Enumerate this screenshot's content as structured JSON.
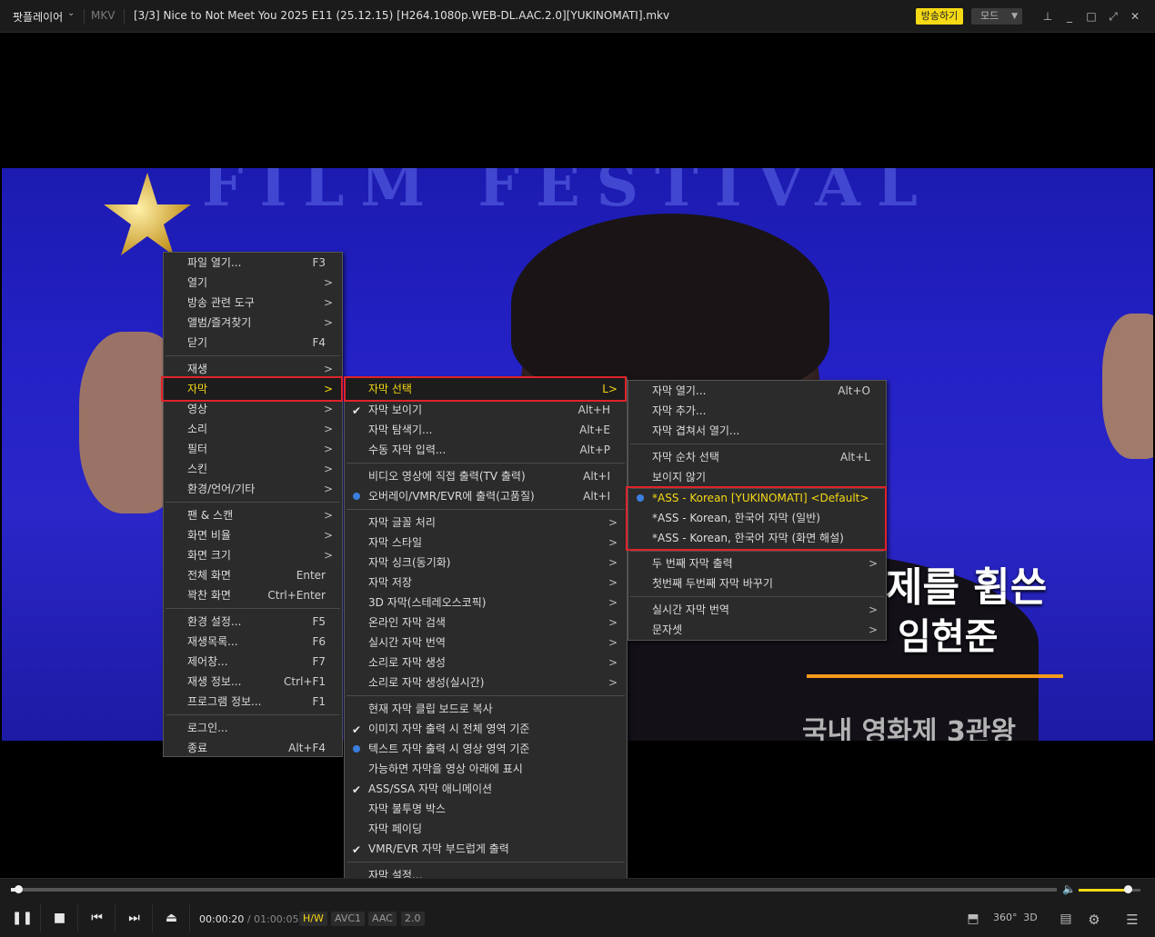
{
  "titlebar": {
    "app_name": "팟플레이어",
    "format": "MKV",
    "file_title": "[3/3] Nice to Not Meet You 2025 E11 (25.12.15) [H264.1080p.WEB-DL.AAC.2.0][YUKINOMATI].mkv",
    "broadcast_label": "방송하기",
    "mode_label": "모드"
  },
  "video": {
    "banner": "FILM FESTIVAL",
    "caption_line1": "제를 휩쓴",
    "caption_line2": "임현준",
    "caption_line3": "국내 영화제 3관왕"
  },
  "menu1": [
    {
      "label": "파일 열기...",
      "shortcut": "F3"
    },
    {
      "label": "열기",
      "arrow": ">"
    },
    {
      "label": "방송 관련 도구",
      "arrow": ">"
    },
    {
      "label": "앨범/즐겨찾기",
      "arrow": ">"
    },
    {
      "label": "닫기",
      "shortcut": "F4"
    },
    {
      "label": "재생",
      "arrow": ">"
    },
    {
      "label": "자막",
      "arrow": ">"
    },
    {
      "label": "영상",
      "arrow": ">"
    },
    {
      "label": "소리",
      "arrow": ">"
    },
    {
      "label": "필터",
      "arrow": ">"
    },
    {
      "label": "스킨",
      "arrow": ">"
    },
    {
      "label": "환경/언어/기타",
      "arrow": ">"
    },
    {
      "label": "팬 & 스캔",
      "arrow": ">"
    },
    {
      "label": "화면 비율",
      "arrow": ">"
    },
    {
      "label": "화면 크기",
      "arrow": ">"
    },
    {
      "label": "전체 화면",
      "shortcut": "Enter"
    },
    {
      "label": "꽉찬 화면",
      "shortcut": "Ctrl+Enter"
    },
    {
      "label": "환경 설정...",
      "shortcut": "F5"
    },
    {
      "label": "재생목록...",
      "shortcut": "F6"
    },
    {
      "label": "제어창...",
      "shortcut": "F7"
    },
    {
      "label": "재생 정보...",
      "shortcut": "Ctrl+F1"
    },
    {
      "label": "프로그램 정보...",
      "shortcut": "F1"
    },
    {
      "label": "로그인..."
    },
    {
      "label": "종료",
      "shortcut": "Alt+F4"
    }
  ],
  "menu2": [
    {
      "label": "자막 선택",
      "shortcut": "L>"
    },
    {
      "label": "자막 보이기",
      "shortcut": "Alt+H"
    },
    {
      "label": "자막 탐색기...",
      "shortcut": "Alt+E"
    },
    {
      "label": "수동 자막 입력...",
      "shortcut": "Alt+P"
    },
    {
      "label": "비디오 영상에 직접 출력(TV 출력)",
      "shortcut": "Alt+I"
    },
    {
      "label": "오버레이/VMR/EVR에 출력(고품질)",
      "shortcut": "Alt+I"
    },
    {
      "label": "자막 글꼴 처리",
      "arrow": ">"
    },
    {
      "label": "자막 스타일",
      "arrow": ">"
    },
    {
      "label": "자막 싱크(동기화)",
      "arrow": ">"
    },
    {
      "label": "자막 저장",
      "arrow": ">"
    },
    {
      "label": "3D 자막(스테레오스코픽)",
      "arrow": ">"
    },
    {
      "label": "온라인 자막 검색",
      "arrow": ">"
    },
    {
      "label": "실시간 자막 번역",
      "arrow": ">"
    },
    {
      "label": "소리로 자막 생성",
      "arrow": ">"
    },
    {
      "label": "소리로 자막 생성(실시간)",
      "arrow": ">"
    },
    {
      "label": "현재 자막 클립 보드로 복사"
    },
    {
      "label": "이미지 자막 출력 시 전체 영역 기준"
    },
    {
      "label": "텍스트 자막 출력 시 영상 영역 기준"
    },
    {
      "label": "가능하면 자막을 영상 아래에 표시"
    },
    {
      "label": "ASS/SSA 자막 애니메이션"
    },
    {
      "label": "자막 불투명 박스"
    },
    {
      "label": "자막 페이딩"
    },
    {
      "label": "VMR/EVR 자막 부드럽게 출력"
    },
    {
      "label": "자막 설정..."
    }
  ],
  "menu3": [
    {
      "label": "자막 열기...",
      "shortcut": "Alt+O"
    },
    {
      "label": "자막 추가..."
    },
    {
      "label": "자막 겹쳐서 열기..."
    },
    {
      "label": "자막 순차 선택",
      "shortcut": "Alt+L"
    },
    {
      "label": "보이지 않기"
    },
    {
      "label": "*ASS - Korean [YUKINOMATI] <Default>"
    },
    {
      "label": "*ASS - Korean, 한국어 자막 (일반)"
    },
    {
      "label": "*ASS - Korean, 한국어 자막 (화면 해설)"
    },
    {
      "label": "두 번째 자막 출력",
      "arrow": ">"
    },
    {
      "label": "첫번째 두번째 자막 바꾸기"
    },
    {
      "label": "실시간 자막 번역",
      "arrow": ">"
    },
    {
      "label": "문자셋",
      "arrow": ">"
    }
  ],
  "controls": {
    "time_current": "00:00:20",
    "time_separator": " / ",
    "time_total": "01:00:05",
    "tags": [
      "H/W",
      "AVC1",
      "AAC",
      "2.0"
    ],
    "seek_progress": 0.006,
    "volume_level": 0.8,
    "right_icons": [
      "360°",
      "3D"
    ]
  },
  "colors": {
    "accent": "#f5d915",
    "highlight_border": "#e0232a",
    "radio_dot": "#3a7fe0"
  }
}
